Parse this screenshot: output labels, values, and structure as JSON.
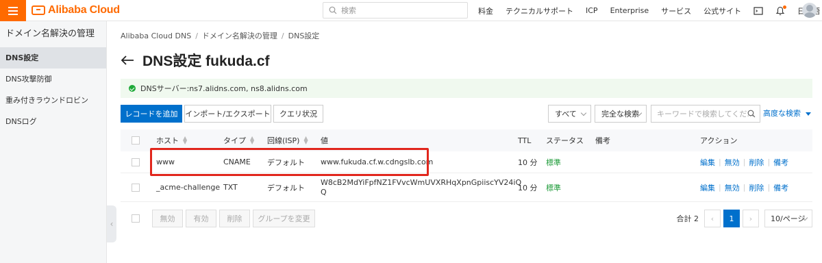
{
  "topbar": {
    "brand": "Alibaba Cloud",
    "search_placeholder": "検索",
    "nav": [
      "料金",
      "テクニカルサポート",
      "ICP",
      "Enterprise",
      "サービス",
      "公式サイト"
    ],
    "language": "日本語"
  },
  "sidebar": {
    "title": "ドメイン名解決の管理",
    "items": [
      {
        "label": "DNS設定",
        "active": true
      },
      {
        "label": "DNS攻撃防御",
        "active": false
      },
      {
        "label": "重み付きラウンドロビン",
        "active": false
      },
      {
        "label": "DNSログ",
        "active": false
      }
    ]
  },
  "breadcrumb": [
    "Alibaba Cloud DNS",
    "ドメイン名解決の管理",
    "DNS設定"
  ],
  "page": {
    "title": "DNS設定 fukuda.cf",
    "notice": "DNSサーバー:ns7.alidns.com, ns8.alidns.com"
  },
  "toolbar": {
    "add_record": "レコードを追加",
    "import_export": "インポート/エクスポート",
    "query_status": "クエリ状況",
    "scope_select": "すべて",
    "match_select": "完全な検索",
    "keyword_placeholder": "キーワードで検索してくだ...",
    "advanced_search": "高度な検索"
  },
  "table": {
    "columns": {
      "host": "ホスト",
      "type": "タイプ",
      "line": "回線(ISP)",
      "value": "値",
      "ttl": "TTL",
      "status": "ステータス",
      "remark": "備考",
      "action": "アクション"
    },
    "rows": [
      {
        "host": "www",
        "type": "CNAME",
        "line": "デフォルト",
        "value": "www.fukuda.cf.w.cdngslb.com",
        "value2": "",
        "ttl": "10 分",
        "status": "標準"
      },
      {
        "host": "_acme-challenge",
        "type": "TXT",
        "line": "デフォルト",
        "value": "W8cB2MdYiFpfNZ1FVvcWmUVXRHqXpnGpiiscYV24iQ",
        "value2": "Q",
        "ttl": "10 分",
        "status": "標準"
      }
    ],
    "row_actions": [
      "編集",
      "無効",
      "削除",
      "備考"
    ]
  },
  "footer": {
    "disable": "無効",
    "enable": "有効",
    "delete": "削除",
    "change_group": "グループを変更",
    "total": "合計 2",
    "current_page": "1",
    "page_size": "10/ページ"
  }
}
